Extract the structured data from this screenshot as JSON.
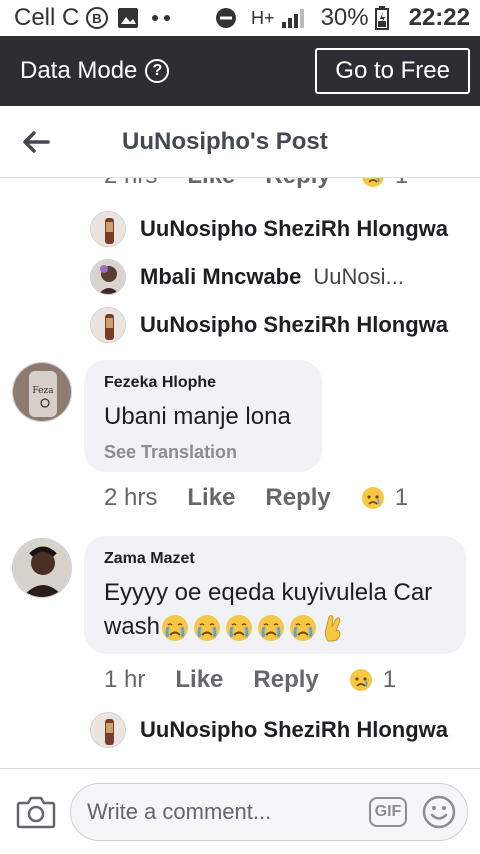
{
  "status_bar": {
    "carrier": "Cell C",
    "network": "H+",
    "battery": "30%",
    "time": "22:22"
  },
  "data_mode_bar": {
    "label": "Data Mode",
    "help_glyph": "?",
    "button_label": "Go to Free"
  },
  "header": {
    "title": "UuNosipho's Post"
  },
  "top_partial_actions": {
    "time": "2 hrs",
    "like": "Like",
    "reply": "Reply",
    "reaction_count": "1"
  },
  "replies_group_1": [
    {
      "name": "UuNosipho SheziRh Hlongwa",
      "snippet": ""
    },
    {
      "name": "Mbali Mncwabe",
      "snippet": "UuNosi..."
    },
    {
      "name": "UuNosipho SheziRh Hlongwa",
      "snippet": ""
    }
  ],
  "comments": [
    {
      "author": "Fezeka Hlophe",
      "text": "Ubani manje lona",
      "see_translation": "See Translation",
      "time": "2 hrs",
      "like": "Like",
      "reply": "Reply",
      "reaction_count": "1"
    },
    {
      "author": "Zama Mazet",
      "text_line1": "Eyyyy oe eqeda kuyivulela Car",
      "text_line2": "wash",
      "time": "1 hr",
      "like": "Like",
      "reply": "Reply",
      "reaction_count": "1"
    }
  ],
  "replies_group_2": [
    {
      "name": "UuNosipho SheziRh Hlongwa"
    }
  ],
  "composer": {
    "placeholder": "Write a comment...",
    "gif_label": "GIF"
  },
  "icons": {
    "status": [
      "b-icon",
      "image-icon",
      "dots-icon",
      "dnd-icon",
      "signal-icon",
      "battery-icon"
    ],
    "reaction": "sad-reaction-icon",
    "emoji": "crying-face-emoji",
    "fingers": "crossed-fingers-emoji"
  },
  "colors": {
    "data_bar_bg": "#2b2f33",
    "bubble_bg": "#f0f2f5",
    "reaction_yellow": "#f7c744",
    "muted_text": "#65676b"
  }
}
